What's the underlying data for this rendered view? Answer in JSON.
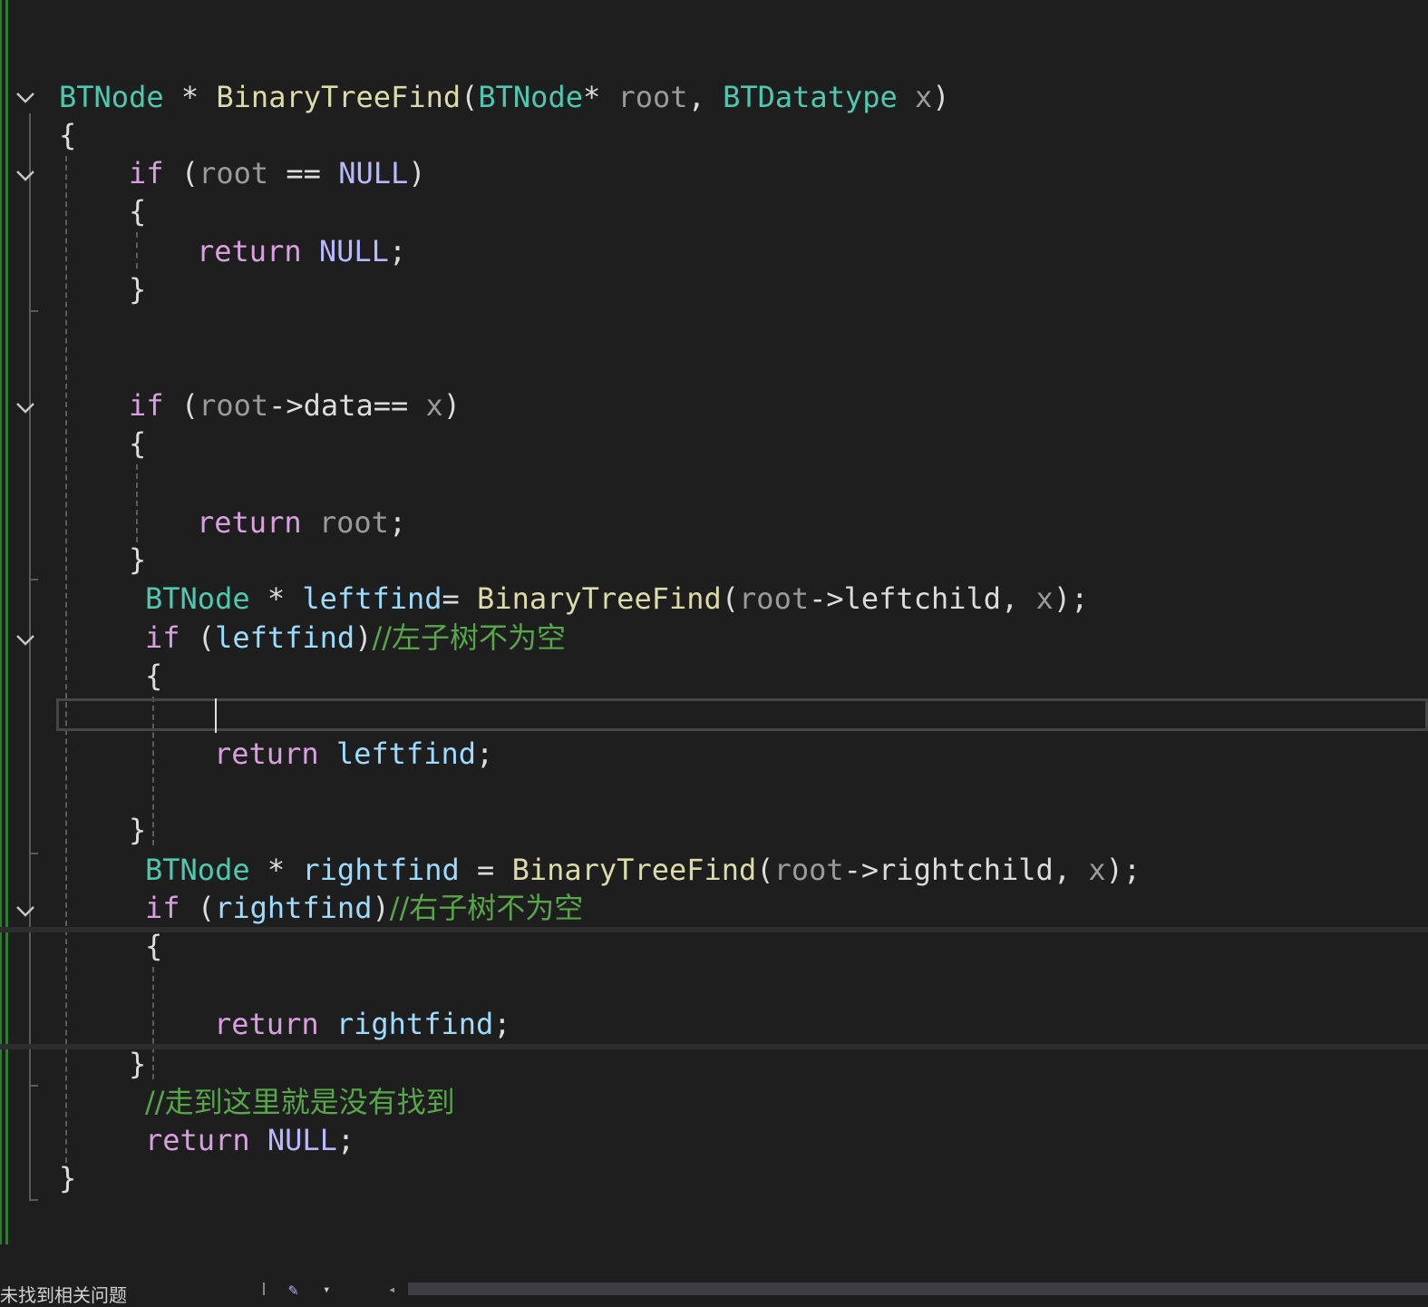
{
  "editor": {
    "lines": [
      {
        "tokens": [
          {
            "text": "BTNode",
            "cls": "t"
          },
          {
            "text": " * ",
            "cls": "w"
          },
          {
            "text": "BinaryTreeFind",
            "cls": "f"
          },
          {
            "text": "(",
            "cls": "w"
          },
          {
            "text": "BTNode",
            "cls": "t"
          },
          {
            "text": "* ",
            "cls": "w"
          },
          {
            "text": "root",
            "cls": "p"
          },
          {
            "text": ", ",
            "cls": "w"
          },
          {
            "text": "BTDatatype",
            "cls": "t"
          },
          {
            "text": " ",
            "cls": "w"
          },
          {
            "text": "x",
            "cls": "p"
          },
          {
            "text": ")",
            "cls": "w"
          }
        ]
      },
      {
        "tokens": [
          {
            "text": "{",
            "cls": "w"
          }
        ]
      },
      {
        "tokens": [
          {
            "text": "if",
            "cls": "k"
          },
          {
            "text": " (",
            "cls": "w"
          },
          {
            "text": "root",
            "cls": "p"
          },
          {
            "text": " == ",
            "cls": "w"
          },
          {
            "text": "NULL",
            "cls": "m"
          },
          {
            "text": ")",
            "cls": "w"
          }
        ]
      },
      {
        "tokens": [
          {
            "text": "{",
            "cls": "w"
          }
        ]
      },
      {
        "tokens": [
          {
            "text": "return",
            "cls": "k"
          },
          {
            "text": " ",
            "cls": "w"
          },
          {
            "text": "NULL",
            "cls": "m"
          },
          {
            "text": ";",
            "cls": "w"
          }
        ]
      },
      {
        "tokens": [
          {
            "text": "}",
            "cls": "w"
          }
        ]
      },
      {
        "tokens": [
          {
            "text": "if",
            "cls": "k"
          },
          {
            "text": " (",
            "cls": "w"
          },
          {
            "text": "root",
            "cls": "p"
          },
          {
            "text": "->",
            "cls": "w"
          },
          {
            "text": "data",
            "cls": "w"
          },
          {
            "text": "== ",
            "cls": "w"
          },
          {
            "text": "x",
            "cls": "p"
          },
          {
            "text": ")",
            "cls": "w"
          }
        ]
      },
      {
        "tokens": [
          {
            "text": "{",
            "cls": "w"
          }
        ]
      },
      {
        "tokens": [
          {
            "text": "return",
            "cls": "k"
          },
          {
            "text": " ",
            "cls": "w"
          },
          {
            "text": "root",
            "cls": "p"
          },
          {
            "text": ";",
            "cls": "w"
          }
        ]
      },
      {
        "tokens": [
          {
            "text": "}",
            "cls": "w"
          }
        ]
      },
      {
        "tokens": [
          {
            "text": "BTNode",
            "cls": "t"
          },
          {
            "text": " * ",
            "cls": "w"
          },
          {
            "text": "leftfind",
            "cls": "v"
          },
          {
            "text": "= ",
            "cls": "w"
          },
          {
            "text": "BinaryTreeFind",
            "cls": "f"
          },
          {
            "text": "(",
            "cls": "w"
          },
          {
            "text": "root",
            "cls": "p"
          },
          {
            "text": "->",
            "cls": "w"
          },
          {
            "text": "leftchild",
            "cls": "w"
          },
          {
            "text": ", ",
            "cls": "w"
          },
          {
            "text": "x",
            "cls": "p"
          },
          {
            "text": ");",
            "cls": "w"
          }
        ]
      },
      {
        "tokens": [
          {
            "text": "if",
            "cls": "k"
          },
          {
            "text": " (",
            "cls": "w"
          },
          {
            "text": "leftfind",
            "cls": "v"
          },
          {
            "text": ")",
            "cls": "w"
          },
          {
            "text": "//左子树不为空",
            "cls": "c"
          }
        ]
      },
      {
        "tokens": [
          {
            "text": "{",
            "cls": "w"
          }
        ]
      },
      {
        "tokens": [
          {
            "text": "return",
            "cls": "k"
          },
          {
            "text": " ",
            "cls": "w"
          },
          {
            "text": "leftfind",
            "cls": "v"
          },
          {
            "text": ";",
            "cls": "w"
          }
        ]
      },
      {
        "tokens": [
          {
            "text": "}",
            "cls": "w"
          }
        ]
      },
      {
        "tokens": [
          {
            "text": "BTNode",
            "cls": "t"
          },
          {
            "text": " * ",
            "cls": "w"
          },
          {
            "text": "rightfind",
            "cls": "v"
          },
          {
            "text": " = ",
            "cls": "w"
          },
          {
            "text": "BinaryTreeFind",
            "cls": "f"
          },
          {
            "text": "(",
            "cls": "w"
          },
          {
            "text": "root",
            "cls": "p"
          },
          {
            "text": "->",
            "cls": "w"
          },
          {
            "text": "rightchild",
            "cls": "w"
          },
          {
            "text": ", ",
            "cls": "w"
          },
          {
            "text": "x",
            "cls": "p"
          },
          {
            "text": ");",
            "cls": "w"
          }
        ]
      },
      {
        "tokens": [
          {
            "text": "if",
            "cls": "k"
          },
          {
            "text": " (",
            "cls": "w"
          },
          {
            "text": "rightfind",
            "cls": "v"
          },
          {
            "text": ")",
            "cls": "w"
          },
          {
            "text": "//右子树不为空",
            "cls": "c"
          }
        ]
      },
      {
        "tokens": [
          {
            "text": "{",
            "cls": "w"
          }
        ]
      },
      {
        "tokens": [
          {
            "text": "return",
            "cls": "k"
          },
          {
            "text": " ",
            "cls": "w"
          },
          {
            "text": "rightfind",
            "cls": "v"
          },
          {
            "text": ";",
            "cls": "w"
          }
        ]
      },
      {
        "tokens": [
          {
            "text": "}",
            "cls": "w"
          }
        ]
      },
      {
        "tokens": [
          {
            "text": "//走到这里就是没有找到",
            "cls": "c"
          }
        ]
      },
      {
        "tokens": [
          {
            "text": "return",
            "cls": "k"
          },
          {
            "text": " ",
            "cls": "w"
          },
          {
            "text": "NULL",
            "cls": "m"
          },
          {
            "text": ";",
            "cls": "w"
          }
        ]
      },
      {
        "tokens": [
          {
            "text": "}",
            "cls": "w"
          }
        ]
      }
    ]
  },
  "statusbar": {
    "issues_text": "未找到相关问题",
    "icon": "brush-icon"
  },
  "colors": {
    "background": "#1e1e1e",
    "type": "#4ec9b0",
    "function": "#dcdcaa",
    "keyword": "#d8a0df",
    "macro": "#b8b8ff",
    "parameter": "#9a9a9a",
    "local": "#9cdcfe",
    "comment": "#57a64a",
    "change_bar": "#2f7d32"
  }
}
